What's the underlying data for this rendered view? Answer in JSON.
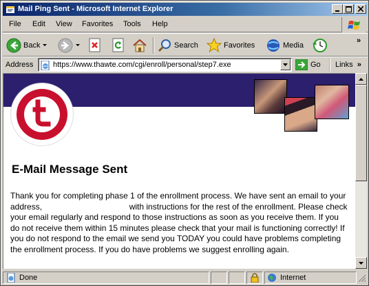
{
  "window": {
    "title": "Mail Ping Sent - Microsoft Internet Explorer"
  },
  "menu": [
    "File",
    "Edit",
    "View",
    "Favorites",
    "Tools",
    "Help"
  ],
  "toolbar": {
    "back": "Back",
    "search": "Search",
    "favorites": "Favorites",
    "media": "Media"
  },
  "address": {
    "label": "Address",
    "url": "https://www.thawte.com/cgi/enroll/personal/step7.exe",
    "go": "Go",
    "links": "Links"
  },
  "page": {
    "heading": "E-Mail Message Sent",
    "para_part1": "Thank you for completing phase 1 of the enrollment process. We have sent an email to your address,",
    "para_part2": "with instructions for the rest of the enrollment. Please check your email regularly and respond to those instructions as soon as you receive them. If you do not receive them within 15 minutes please check that your mail is functioning correctly! If you do not respond to the email we send you TODAY you could have problems completing the enrollment process. If you do have problems we suggest enrolling again."
  },
  "status": {
    "text": "Done",
    "zone": "Internet"
  },
  "colors": {
    "banner": "#2c1f6e",
    "logo_red": "#c8102e",
    "titlebar": "#0a246a"
  }
}
